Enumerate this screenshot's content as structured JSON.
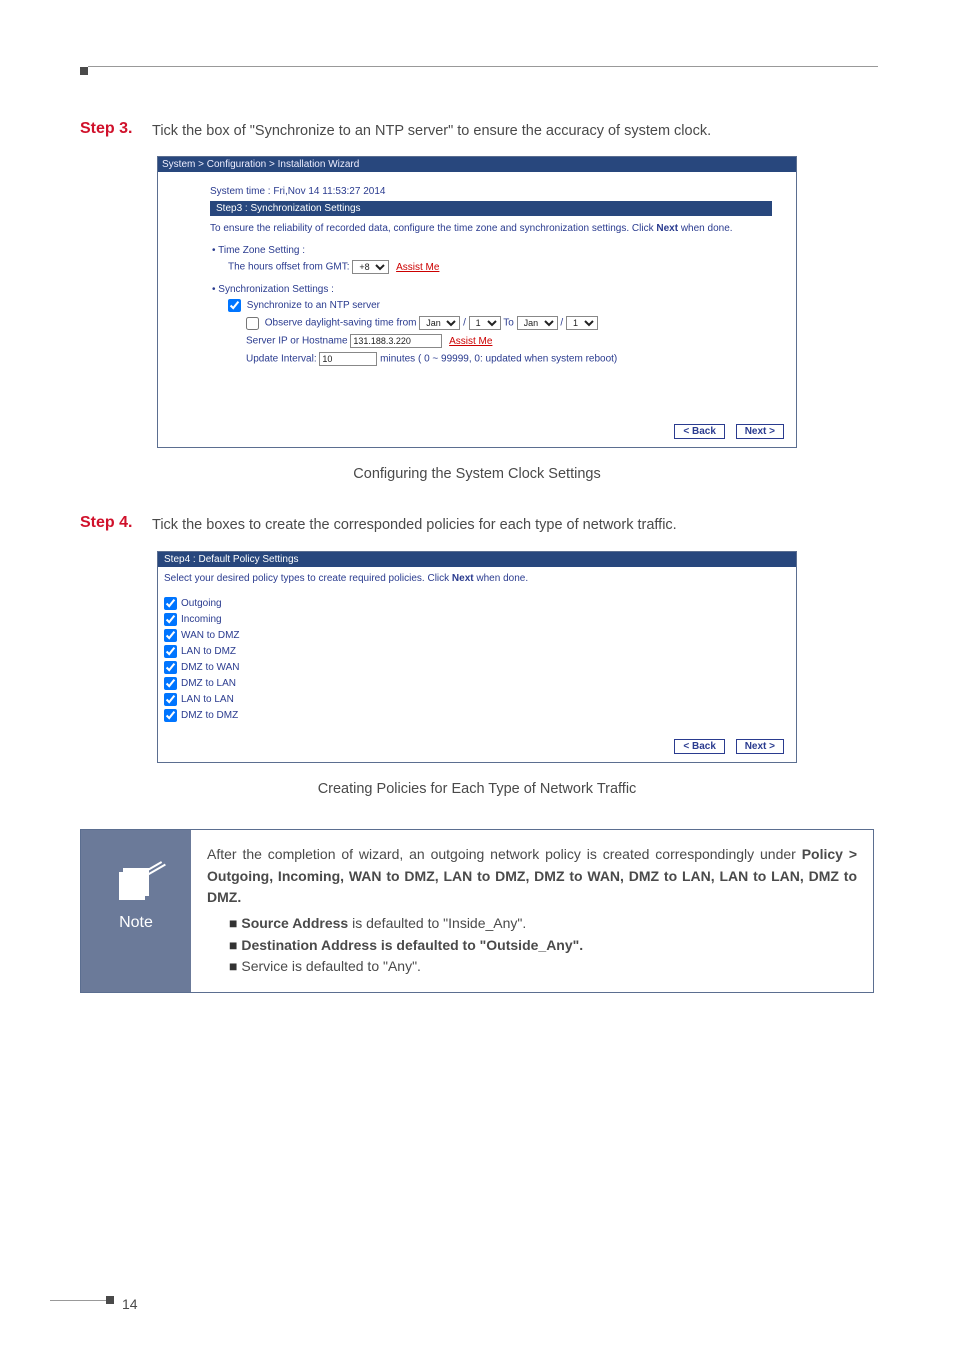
{
  "page_number": "14",
  "step3": {
    "label": "Step 3.",
    "text": "Tick the box of \"Synchronize to an NTP server\" to ensure the accuracy of system clock."
  },
  "shot1": {
    "breadcrumb": "System > Configuration > Installation Wizard",
    "system_time": "System time : Fri,Nov 14 11:53:27 2014",
    "section_title": "Step3 : Synchronization Settings",
    "help_prefix": "To ensure the reliability of recorded data, configure the time zone and synchronization settings. Click ",
    "help_bold": "Next",
    "help_suffix": " when done.",
    "tz_heading": "Time Zone Setting :",
    "tz_offset_label": "The hours offset from GMT:",
    "tz_offset_value": "+8",
    "assist": "Assist Me",
    "sync_heading": "Synchronization Settings :",
    "sync_ntp_label": "Synchronize to an NTP server",
    "dst_label": "Observe daylight-saving time from",
    "dst_month1": "Jan",
    "dst_day1": "1",
    "dst_to": "To",
    "dst_month2": "Jan",
    "dst_day2": "1",
    "server_label": "Server IP or Hostname",
    "server_value": "131.188.3.220",
    "interval_label": "Update Interval:",
    "interval_value": "10",
    "interval_hint": "minutes ( 0 ~ 99999, 0: updated when system reboot)",
    "back": "< Back",
    "next": "Next >"
  },
  "caption1": "Configuring the System Clock Settings",
  "step4": {
    "label": "Step 4.",
    "text": "Tick the boxes to create the corresponded policies for each type of network traffic."
  },
  "shot2": {
    "section_title": "Step4 : Default Policy Settings",
    "help_prefix": "Select your desired policy types to create required policies. Click ",
    "help_bold": "Next",
    "help_suffix": " when done.",
    "items": {
      "0": "Outgoing",
      "1": "Incoming",
      "2": "WAN to DMZ",
      "3": "LAN to DMZ",
      "4": "DMZ to WAN",
      "5": "DMZ to LAN",
      "6": "LAN to LAN",
      "7": "DMZ to DMZ"
    },
    "back": "< Back",
    "next": "Next >"
  },
  "caption2": "Creating Policies for Each Type of Network Traffic",
  "note": {
    "label": "Note",
    "p1a": "After the completion of wizard, an outgoing network policy is created correspondingly under ",
    "p1b": "Policy > Outgoing, Incoming, WAN to DMZ, LAN to DMZ, DMZ to WAN, DMZ to LAN, LAN to LAN, DMZ to DMZ.",
    "b1a": "Source Address",
    "b1b": " is defaulted to \"Inside_Any\".",
    "b2": "Destination Address is defaulted to \"Outside_Any\".",
    "b3": "Service is defaulted to \"Any\"."
  }
}
